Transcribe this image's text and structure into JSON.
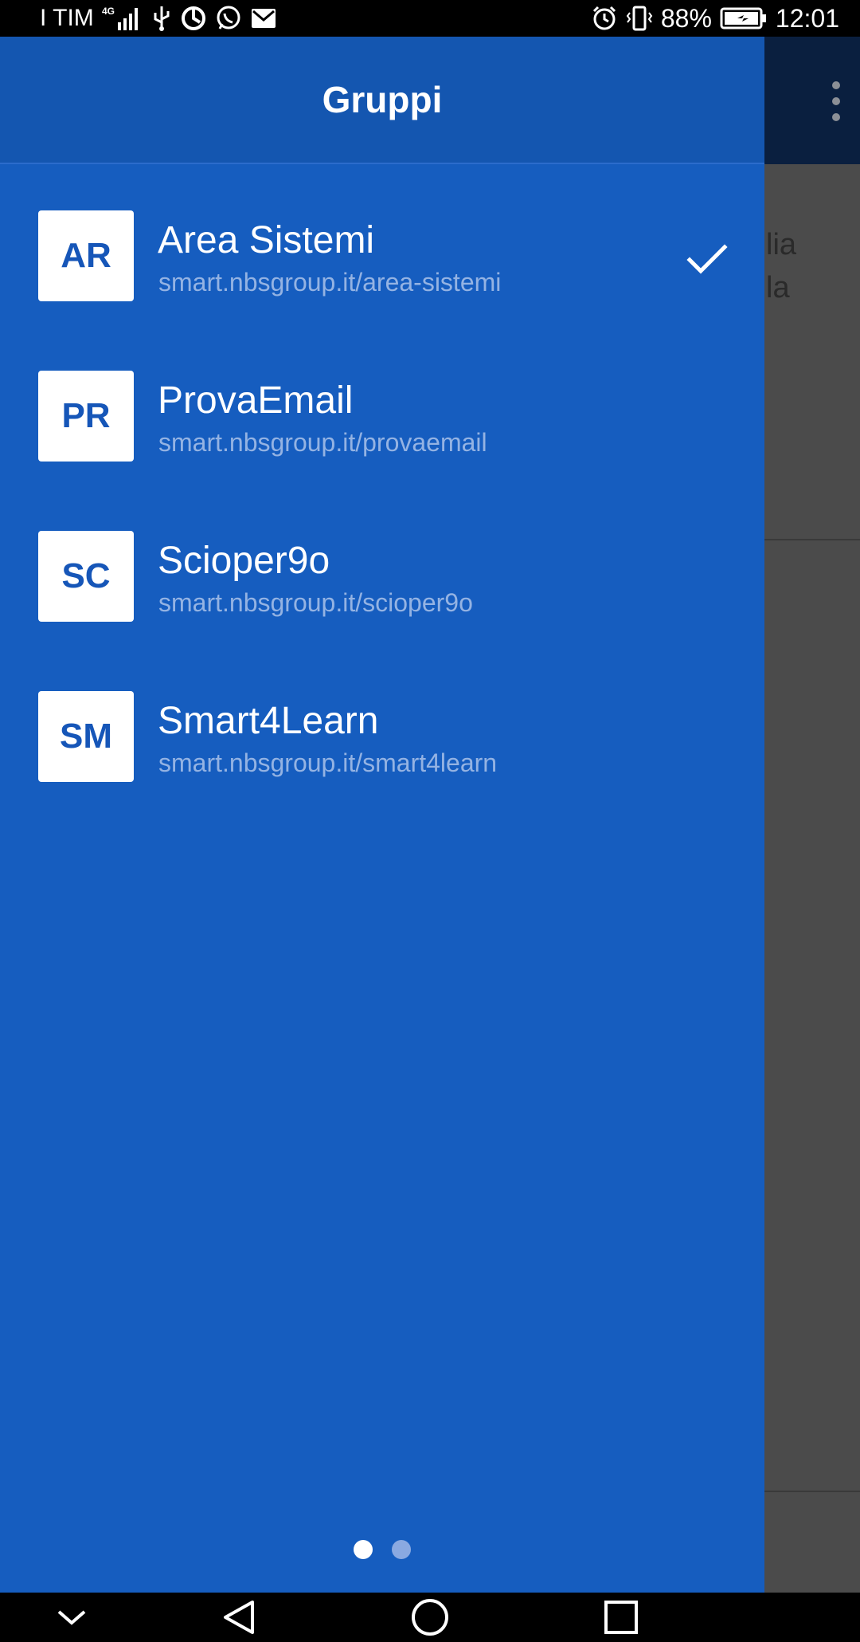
{
  "status_bar": {
    "carrier": "I TIM",
    "network": "4G",
    "battery": "88%",
    "time": "12:01",
    "left_icons": [
      "signal-icon",
      "usb-icon",
      "sync-icon",
      "whatsapp-icon",
      "mail-icon"
    ],
    "right_icons": [
      "alarm-icon",
      "vibrate-icon",
      "battery-icon"
    ]
  },
  "drawer": {
    "title": "Gruppi",
    "groups": [
      {
        "initials": "AR",
        "name": "Area Sistemi",
        "url": "smart.nbsgroup.it/area-sistemi",
        "selected": true
      },
      {
        "initials": "PR",
        "name": "ProvaEmail",
        "url": "smart.nbsgroup.it/provaemail",
        "selected": false
      },
      {
        "initials": "SC",
        "name": "Scioper9o",
        "url": "smart.nbsgroup.it/scioper9o",
        "selected": false
      },
      {
        "initials": "SM",
        "name": "Smart4Learn",
        "url": "smart.nbsgroup.it/smart4learn",
        "selected": false
      }
    ],
    "page_indicator": {
      "total": 2,
      "current": 1
    }
  },
  "background_app": {
    "visible_text_line1": "lia",
    "visible_text_line2": "la"
  },
  "navigation_bar": {
    "buttons": [
      "collapse-icon",
      "back-icon",
      "home-icon",
      "recents-icon"
    ]
  },
  "colors": {
    "drawer_bg": "#165dbf",
    "header_bg": "#1456b0",
    "accent_text": "#1656b8",
    "url_text": "#94b3e3"
  }
}
